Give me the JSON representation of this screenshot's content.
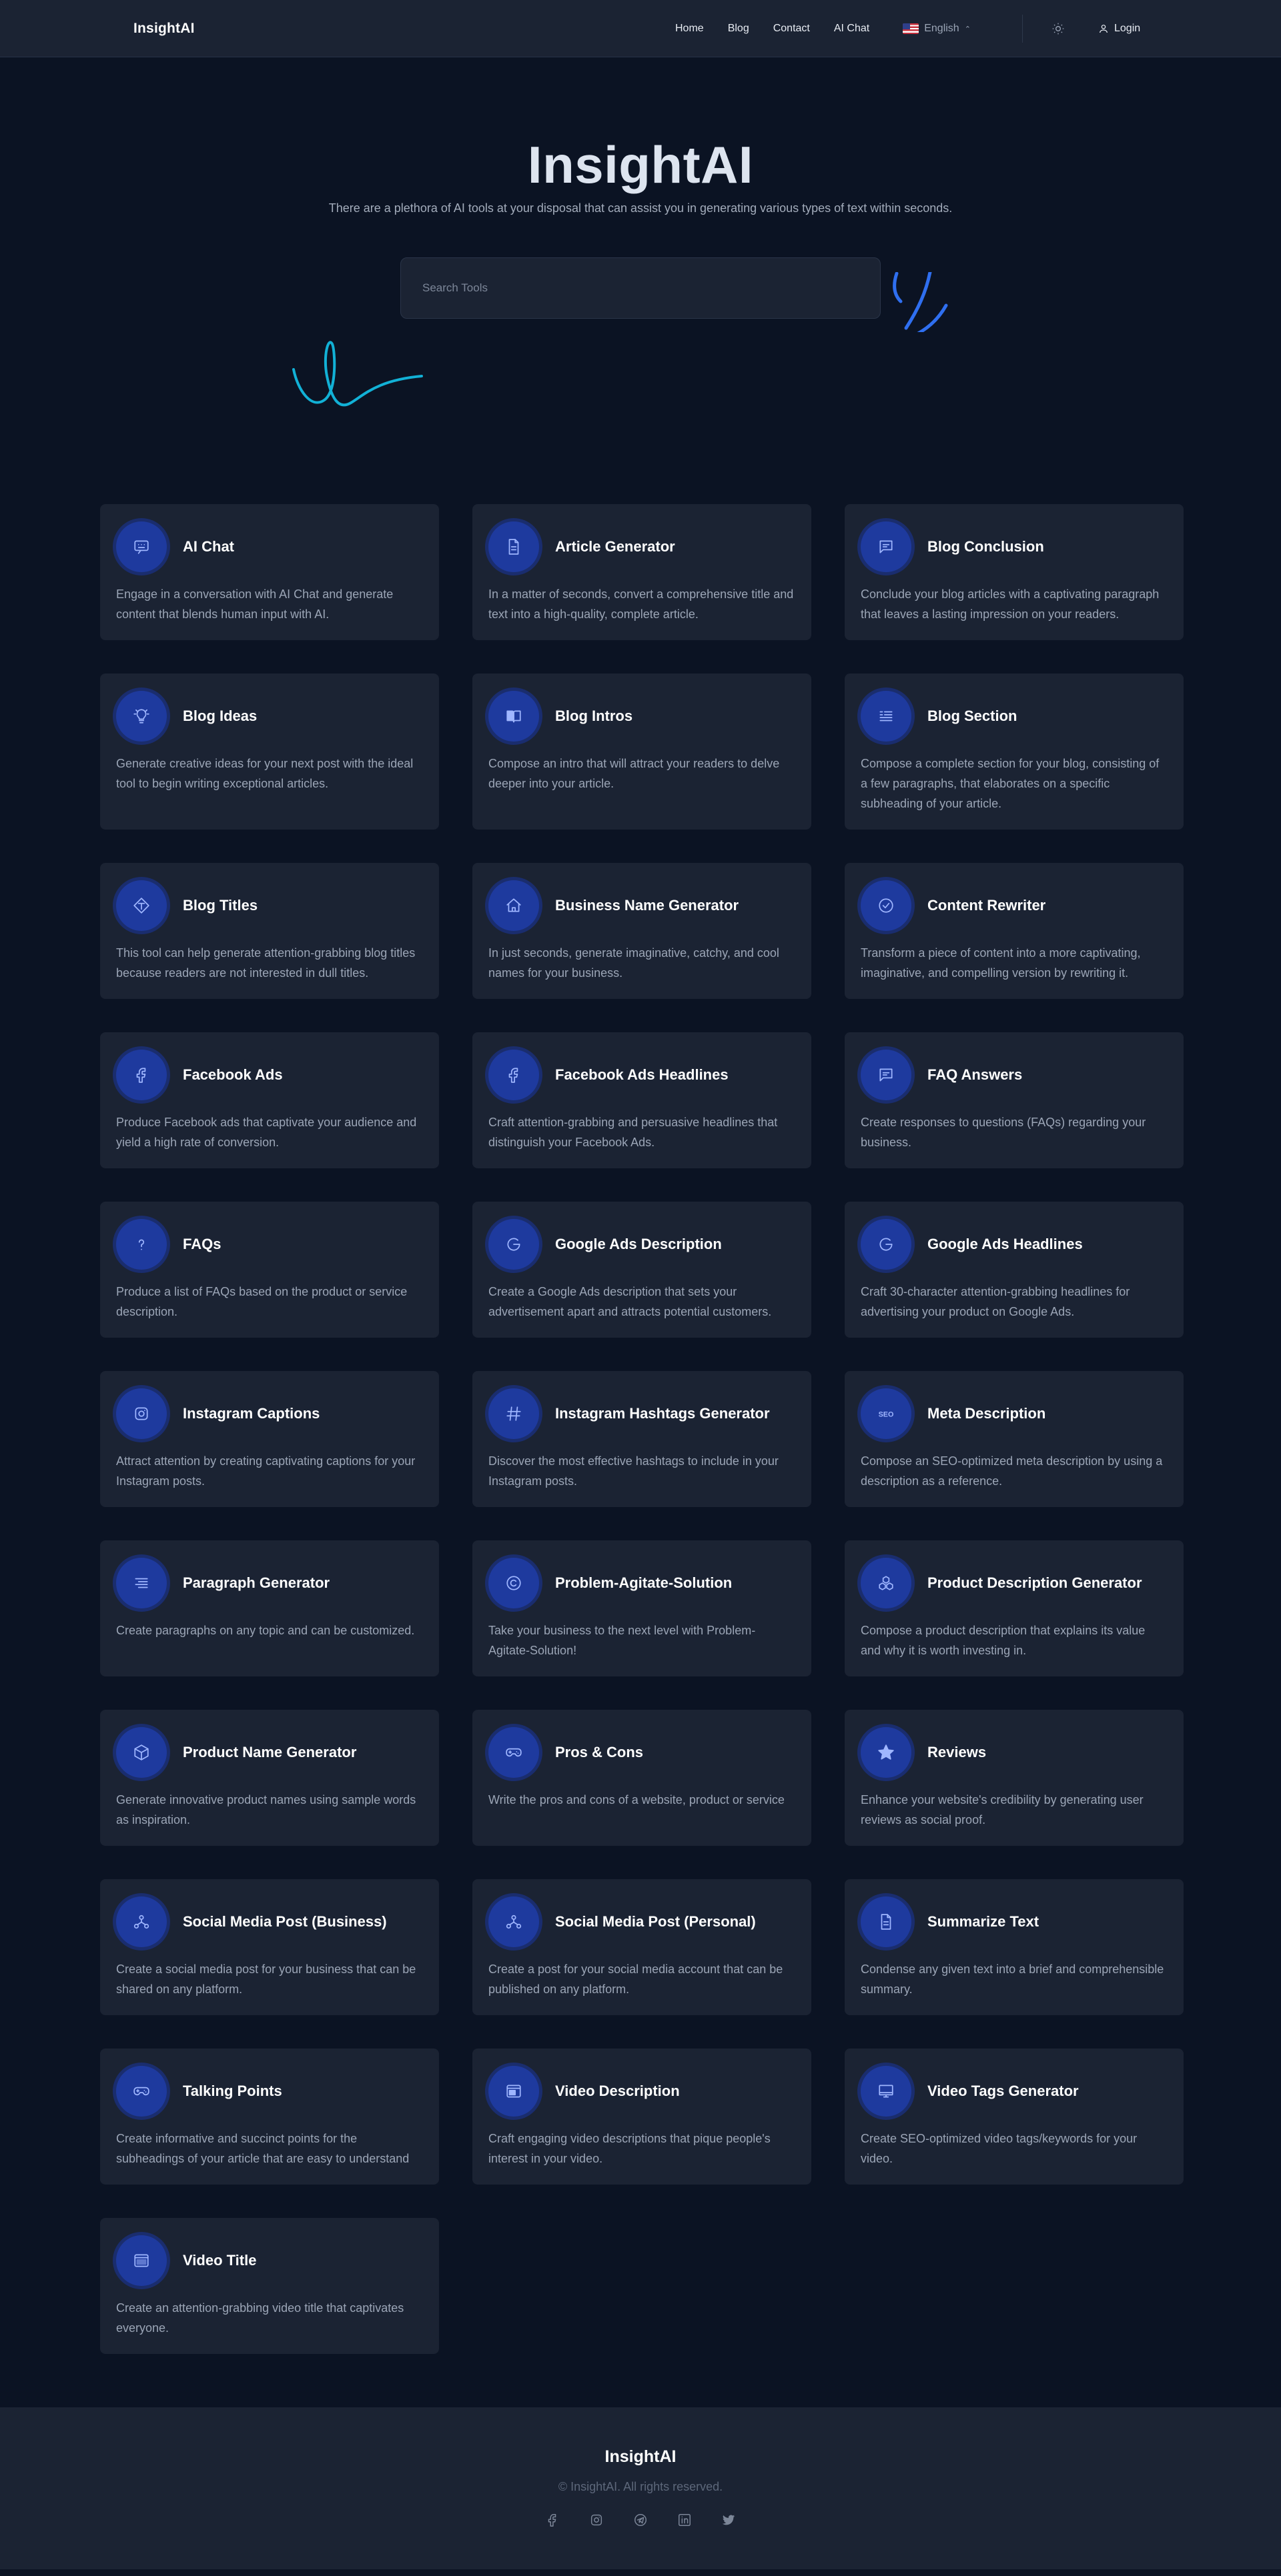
{
  "nav": {
    "brand": "InsightAI",
    "links": [
      "Home",
      "Blog",
      "Contact",
      "AI Chat"
    ],
    "language": "English",
    "login": "Login"
  },
  "hero": {
    "title": "InsightAI",
    "subtitle": "There are a plethora of AI tools at your disposal that can assist you in generating various types of text within seconds.",
    "search_placeholder": "Search Tools"
  },
  "colors": {
    "background": "#0b1323",
    "card": "#1b2333",
    "icon_bg": "#1e3a9e",
    "accent_squiggle": "#12b1d6",
    "accent_strokes": "#2f6ff0"
  },
  "tools": [
    {
      "title": "AI Chat",
      "icon": "chat-icon",
      "desc": "Engage in a conversation with AI Chat and generate content that blends human input with AI."
    },
    {
      "title": "Article Generator",
      "icon": "document-icon",
      "desc": "In a matter of seconds, convert a comprehensive title and text into a high-quality, complete article."
    },
    {
      "title": "Blog Conclusion",
      "icon": "message-icon",
      "desc": "Conclude your blog articles with a captivating paragraph that leaves a lasting impression on your readers."
    },
    {
      "title": "Blog Ideas",
      "icon": "lightbulb-icon",
      "desc": "Generate creative ideas for your next post with the ideal tool to begin writing exceptional articles."
    },
    {
      "title": "Blog Intros",
      "icon": "book-icon",
      "desc": "Compose an intro that will attract your readers to delve deeper into your article."
    },
    {
      "title": "Blog Section",
      "icon": "list-icon",
      "desc": "Compose a complete section for your blog, consisting of a few paragraphs, that elaborates on a specific subheading of your article."
    },
    {
      "title": "Blog Titles",
      "icon": "title-icon",
      "desc": "This tool can help generate attention-grabbing blog titles because readers are not interested in dull titles."
    },
    {
      "title": "Business Name Generator",
      "icon": "home-icon",
      "desc": "In just seconds, generate imaginative, catchy, and cool names for your business."
    },
    {
      "title": "Content Rewriter",
      "icon": "check-circle-icon",
      "desc": "Transform a piece of content into a more captivating, imaginative, and compelling version by rewriting it."
    },
    {
      "title": "Facebook Ads",
      "icon": "facebook-icon",
      "desc": "Produce Facebook ads that captivate your audience and yield a high rate of conversion."
    },
    {
      "title": "Facebook Ads Headlines",
      "icon": "facebook-icon",
      "desc": "Craft attention-grabbing and persuasive headlines that distinguish your Facebook Ads."
    },
    {
      "title": "FAQ Answers",
      "icon": "message-icon",
      "desc": "Create responses to questions (FAQs) regarding your business."
    },
    {
      "title": "FAQs",
      "icon": "question-icon",
      "desc": "Produce a list of FAQs based on the product or service description."
    },
    {
      "title": "Google Ads Description",
      "icon": "google-icon",
      "desc": "Create a Google Ads description that sets your advertisement apart and attracts potential customers."
    },
    {
      "title": "Google Ads Headlines",
      "icon": "google-icon",
      "desc": "Craft 30-character attention-grabbing headlines for advertising your product on Google Ads."
    },
    {
      "title": "Instagram Captions",
      "icon": "instagram-icon",
      "desc": "Attract attention by creating captivating captions for your Instagram posts."
    },
    {
      "title": "Instagram Hashtags Generator",
      "icon": "hashtag-icon",
      "desc": "Discover the most effective hashtags to include in your Instagram posts."
    },
    {
      "title": "Meta Description",
      "icon": "seo-icon",
      "desc": "Compose an SEO-optimized meta description by using a description as a reference."
    },
    {
      "title": "Paragraph Generator",
      "icon": "paragraph-icon",
      "desc": "Create paragraphs on any topic and can be customized."
    },
    {
      "title": "Problem-Agitate-Solution",
      "icon": "copyright-icon",
      "desc": "Take your business to the next level with Problem-Agitate-Solution!"
    },
    {
      "title": "Product Description Generator",
      "icon": "cubes-icon",
      "desc": "Compose a product description that explains its value and why it is worth investing in."
    },
    {
      "title": "Product Name Generator",
      "icon": "box-icon",
      "desc": "Generate innovative product names using sample words as inspiration."
    },
    {
      "title": "Pros & Cons",
      "icon": "gamepad-icon",
      "desc": "Write the pros and cons of a website, product or service"
    },
    {
      "title": "Reviews",
      "icon": "star-icon",
      "desc": "Enhance your website's credibility by generating user reviews as social proof."
    },
    {
      "title": "Social Media Post (Business)",
      "icon": "share-icon",
      "desc": "Create a social media post for your business that can be shared on any platform."
    },
    {
      "title": "Social Media Post (Personal)",
      "icon": "share-icon",
      "desc": "Create a post for your social media account that can be published on any platform."
    },
    {
      "title": "Summarize Text",
      "icon": "document-icon",
      "desc": "Condense any given text into a brief and comprehensible summary."
    },
    {
      "title": "Talking Points",
      "icon": "gamepad-icon",
      "desc": "Create informative and succinct points for the subheadings of your article that are easy to understand"
    },
    {
      "title": "Video Description",
      "icon": "video-icon",
      "desc": "Craft engaging video descriptions that pique people's interest in your video."
    },
    {
      "title": "Video Tags Generator",
      "icon": "monitor-icon",
      "desc": "Create SEO-optimized video tags/keywords for your video."
    },
    {
      "title": "Video Title",
      "icon": "window-icon",
      "desc": "Create an attention-grabbing video title that captivates everyone."
    }
  ],
  "footer": {
    "brand": "InsightAI",
    "copyright": "© InsightAI. All rights reserved.",
    "socials": [
      "facebook-icon",
      "instagram-icon",
      "telegram-icon",
      "linkedin-icon",
      "twitter-icon"
    ]
  }
}
